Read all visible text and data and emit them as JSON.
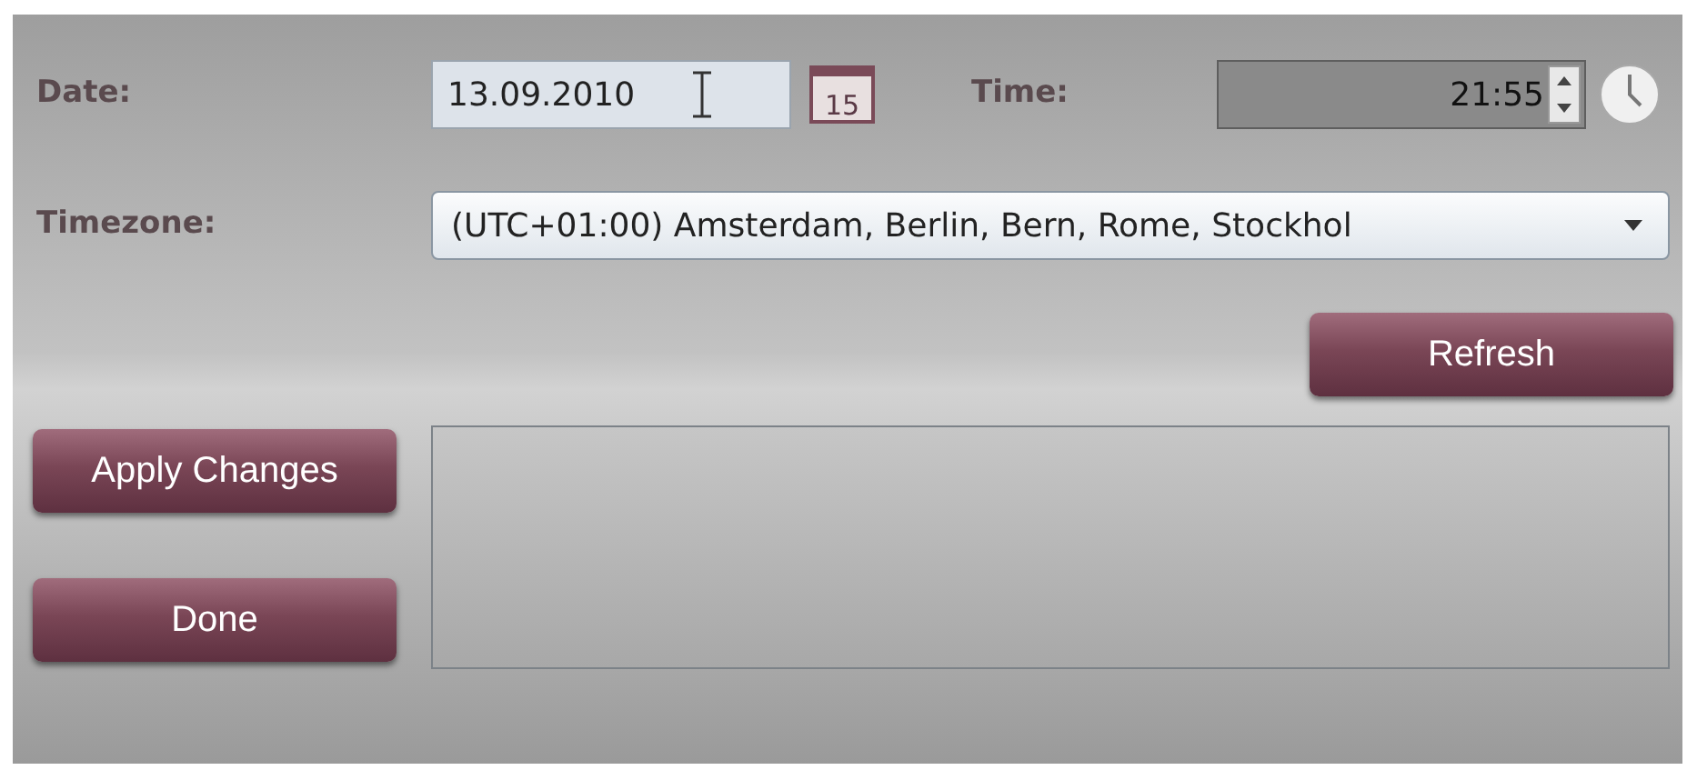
{
  "date": {
    "label": "Date:",
    "value": "13.09.2010",
    "calendar_day": "15"
  },
  "time": {
    "label": "Time:",
    "value": "21:55"
  },
  "timezone": {
    "label": "Timezone:",
    "value": "(UTC+01:00) Amsterdam, Berlin, Bern, Rome, Stockhol"
  },
  "buttons": {
    "refresh": "Refresh",
    "apply": "Apply Changes",
    "done": "Done"
  }
}
